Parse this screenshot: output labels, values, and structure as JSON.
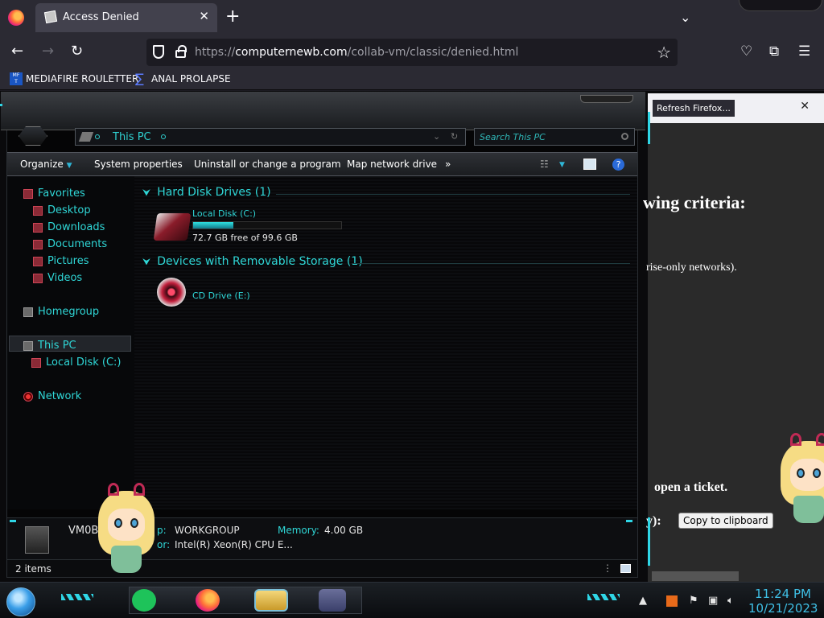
{
  "browser": {
    "tab_title": "Access Denied",
    "url_scheme": "https://",
    "url_host": "computernewb.com",
    "url_path": "/collab-vm/classic/denied.html",
    "bookmarks": [
      {
        "label": "MEDIAFIRE ROULETTER",
        "icon": "mf-icon"
      },
      {
        "label": "ANAL PROLAPSE",
        "icon": "sigma-icon"
      }
    ]
  },
  "webpage": {
    "refresh_button": "Refresh Firefox...",
    "line1": "wing criteria:",
    "line2": "rise-only networks).",
    "line3": "open a ticket.",
    "line4": "y):",
    "copy_button": "Copy to clipboard"
  },
  "explorer": {
    "address": "This PC",
    "search_placeholder": "Search This PC",
    "commands": [
      "Organize",
      "System properties",
      "Uninstall or change a program",
      "Map network drive",
      "»"
    ],
    "nav": {
      "favorites": "Favorites",
      "desktop": "Desktop",
      "downloads": "Downloads",
      "documents": "Documents",
      "pictures": "Pictures",
      "videos": "Videos",
      "homegroup": "Homegroup",
      "this_pc": "This PC",
      "local_disk": "Local Disk (C:)",
      "network": "Network"
    },
    "groups": {
      "hdd": "Hard Disk Drives (1)",
      "removable": "Devices with Removable Storage (1)"
    },
    "drives": {
      "c_name": "Local Disk (C:)",
      "c_free": "72.7 GB free of 99.6 GB",
      "c_used_fraction": 0.27,
      "e_name": "CD Drive (E:)"
    },
    "details": {
      "pc_name": "VM0B",
      "workgroup_label": "p:",
      "workgroup": "WORKGROUP",
      "memory_label": "Memory:",
      "memory": "4.00 GB",
      "processor_label": "or:",
      "processor": "Intel(R) Xeon(R) CPU E..."
    },
    "status": "2 items"
  },
  "taskbar": {
    "time": "11:24 PM",
    "date": "10/21/2023"
  }
}
